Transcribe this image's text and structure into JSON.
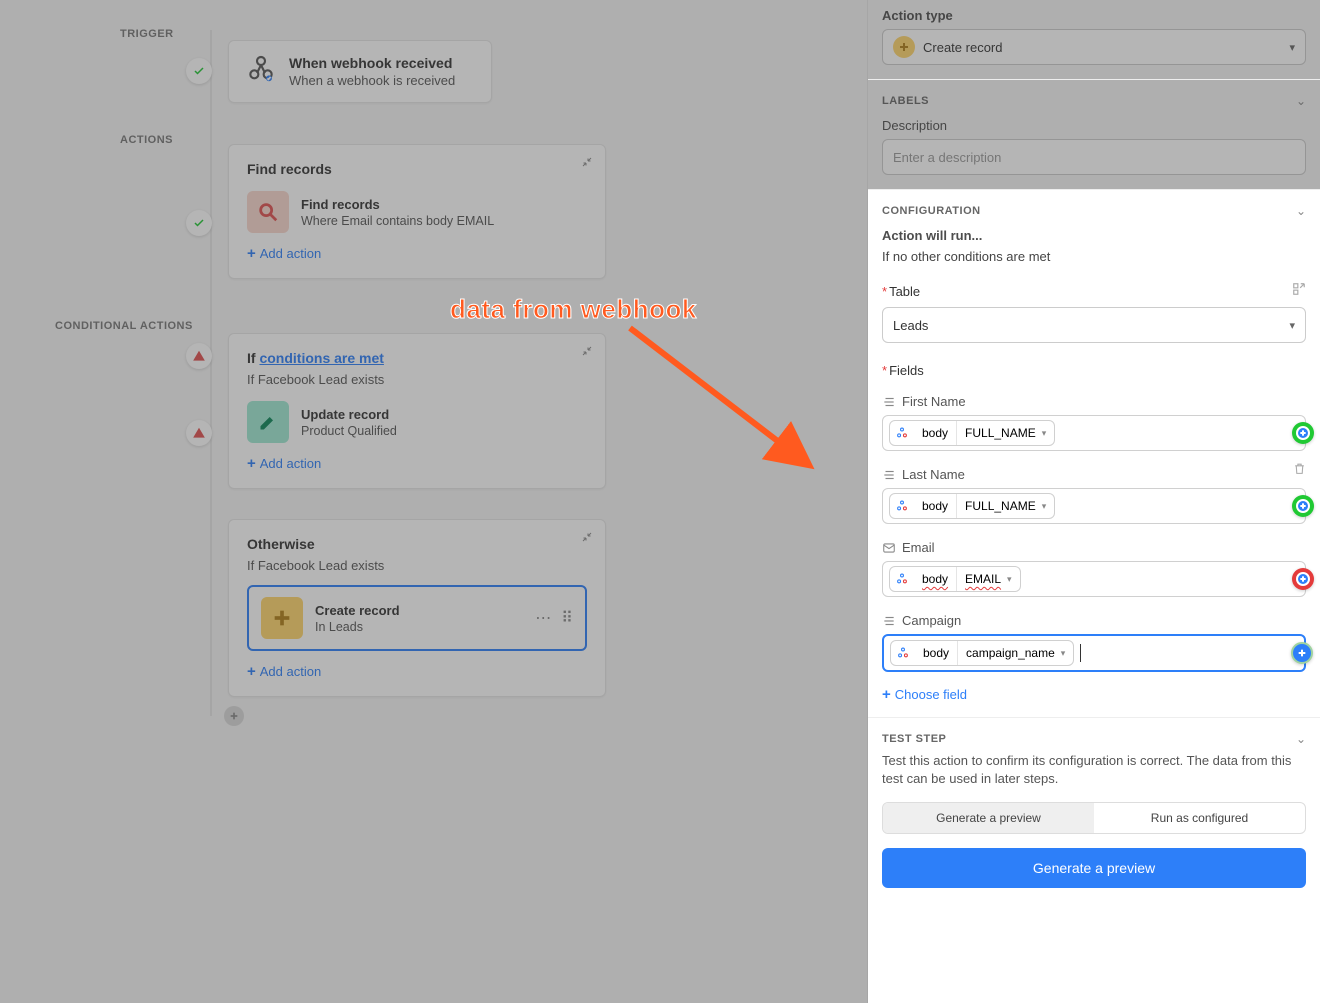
{
  "sections": {
    "trigger": "TRIGGER",
    "actions": "ACTIONS",
    "conditional": "CONDITIONAL ACTIONS"
  },
  "trigger_card": {
    "title": "When webhook received",
    "sub": "When a webhook is received"
  },
  "find_group": {
    "title": "Find records",
    "item_title": "Find records",
    "item_sub": "Where Email contains body EMAIL"
  },
  "cond_group": {
    "prefix": "If ",
    "link": "conditions are met",
    "sub": "If Facebook Lead exists",
    "item_title": "Update record",
    "item_sub": "Product Qualified"
  },
  "otherwise_group": {
    "title": "Otherwise",
    "sub": "If Facebook Lead exists",
    "item_title": "Create record",
    "item_sub": "In Leads"
  },
  "add_action": "Add action",
  "annotation": "data from webhook",
  "panel": {
    "action_type_label": "Action type",
    "action_type_value": "Create record",
    "labels_header": "LABELS",
    "description_label": "Description",
    "description_placeholder": "Enter a description",
    "config_header": "CONFIGURATION",
    "run_label": "Action will run...",
    "run_value": "If no other conditions are met",
    "table_label": "Table",
    "table_value": "Leads",
    "fields_label": "Fields",
    "fields": {
      "first_name": {
        "label": "First Name",
        "chip_a": "body",
        "chip_b": "FULL_NAME"
      },
      "last_name": {
        "label": "Last Name",
        "chip_a": "body",
        "chip_b": "FULL_NAME"
      },
      "email": {
        "label": "Email",
        "chip_a": "body",
        "chip_b": "EMAIL"
      },
      "campaign": {
        "label": "Campaign",
        "chip_a": "body",
        "chip_b": "campaign_name"
      }
    },
    "choose_field": "Choose field",
    "test_header": "TEST STEP",
    "test_desc": "Test this action to confirm its configuration is correct. The data from this test can be used in later steps.",
    "seg_a": "Generate a preview",
    "seg_b": "Run as configured",
    "primary": "Generate a preview"
  }
}
